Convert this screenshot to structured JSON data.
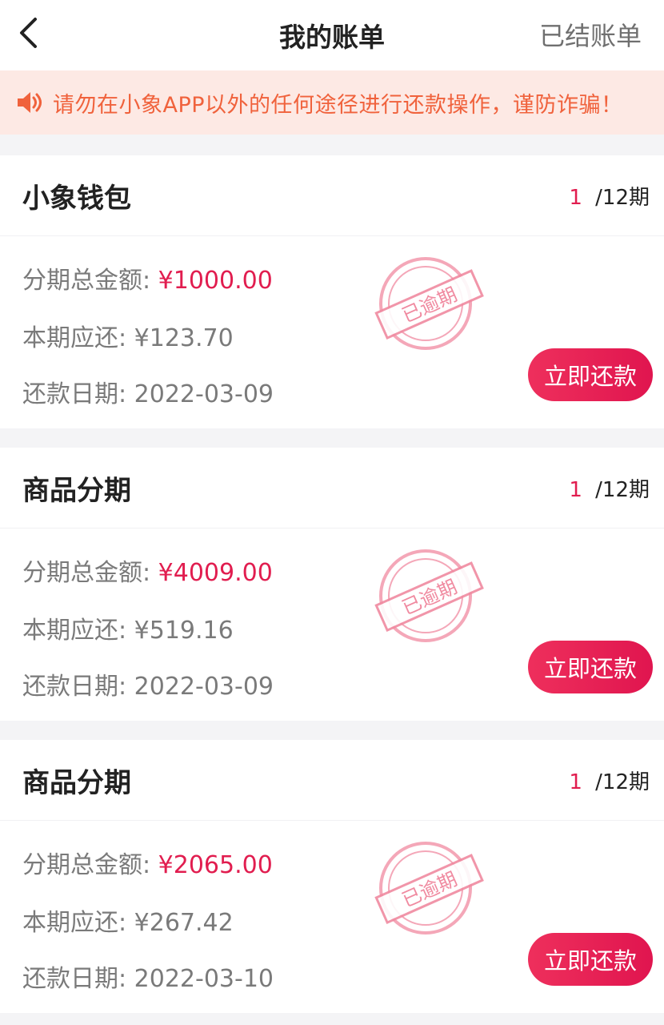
{
  "header": {
    "title": "我的账单",
    "right_link": "已结账单"
  },
  "notice": {
    "text": "请勿在小象APP以外的任何途径进行还款操作，谨防诈骗！",
    "color": "#f0623c"
  },
  "labels": {
    "total": "分期总金额: ",
    "due": "本期应还: ",
    "date": "还款日期: ",
    "stamp": "已逾期",
    "pay_button": "立即还款"
  },
  "colors": {
    "accent": "#e11d4f",
    "stamp": "#f08aa0"
  },
  "bills": [
    {
      "name": "小象钱包",
      "current": "1",
      "total_periods": " /12期",
      "total_amount": "¥1000.00",
      "due_amount": "¥123.70",
      "due_date": "2022-03-09"
    },
    {
      "name": "商品分期",
      "current": "1",
      "total_periods": " /12期",
      "total_amount": "¥4009.00",
      "due_amount": "¥519.16",
      "due_date": "2022-03-09"
    },
    {
      "name": "商品分期",
      "current": "1",
      "total_periods": " /12期",
      "total_amount": "¥2065.00",
      "due_amount": "¥267.42",
      "due_date": "2022-03-10"
    }
  ]
}
